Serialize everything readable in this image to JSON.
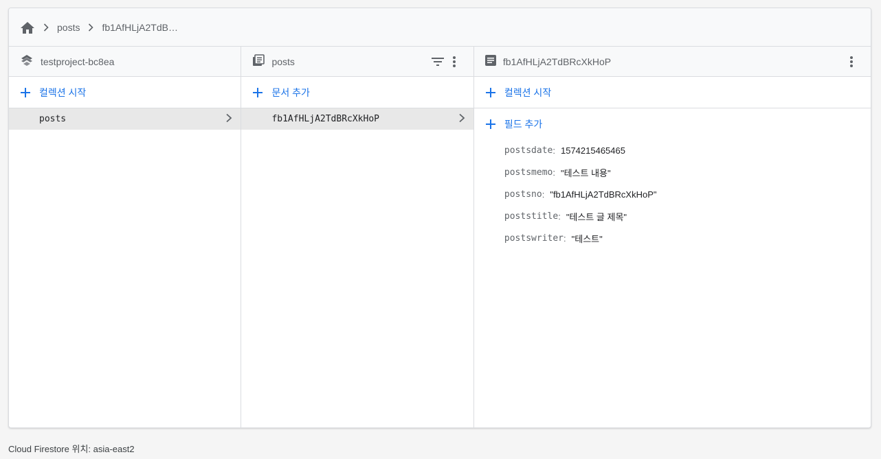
{
  "breadcrumb": {
    "home_icon": "home-icon",
    "items": [
      "posts",
      "fb1AfHLjA2TdB…"
    ]
  },
  "columns": {
    "project": {
      "icon": "project-stack-icon",
      "title": "testproject-bc8ea",
      "action_label": "컬렉션 시작",
      "items": [
        {
          "label": "posts",
          "selected": true
        }
      ]
    },
    "collection": {
      "icon": "collection-icon",
      "title": "posts",
      "action_label": "문서 추가",
      "items": [
        {
          "label": "fb1AfHLjA2TdBRcXkHoP",
          "selected": true
        }
      ]
    },
    "document": {
      "icon": "document-icon",
      "title": "fb1AfHLjA2TdBRcXkHoP",
      "action_label": "컬렉션 시작",
      "add_field_label": "필드 추가",
      "fields": [
        {
          "key": "postsdate",
          "value": "1574215465465"
        },
        {
          "key": "postsmemo",
          "value": "\"테스트 내용\""
        },
        {
          "key": "postsno",
          "value": "\"fb1AfHLjA2TdBRcXkHoP\""
        },
        {
          "key": "poststitle",
          "value": "\"테스트 글 제목\""
        },
        {
          "key": "postswriter",
          "value": "\"테스트\""
        }
      ]
    }
  },
  "footer": "Cloud Firestore 위치: asia-east2",
  "colors": {
    "accent": "#1a73e8",
    "selected_bg": "#e8e8e8",
    "header_bg": "#f8f9fa"
  }
}
